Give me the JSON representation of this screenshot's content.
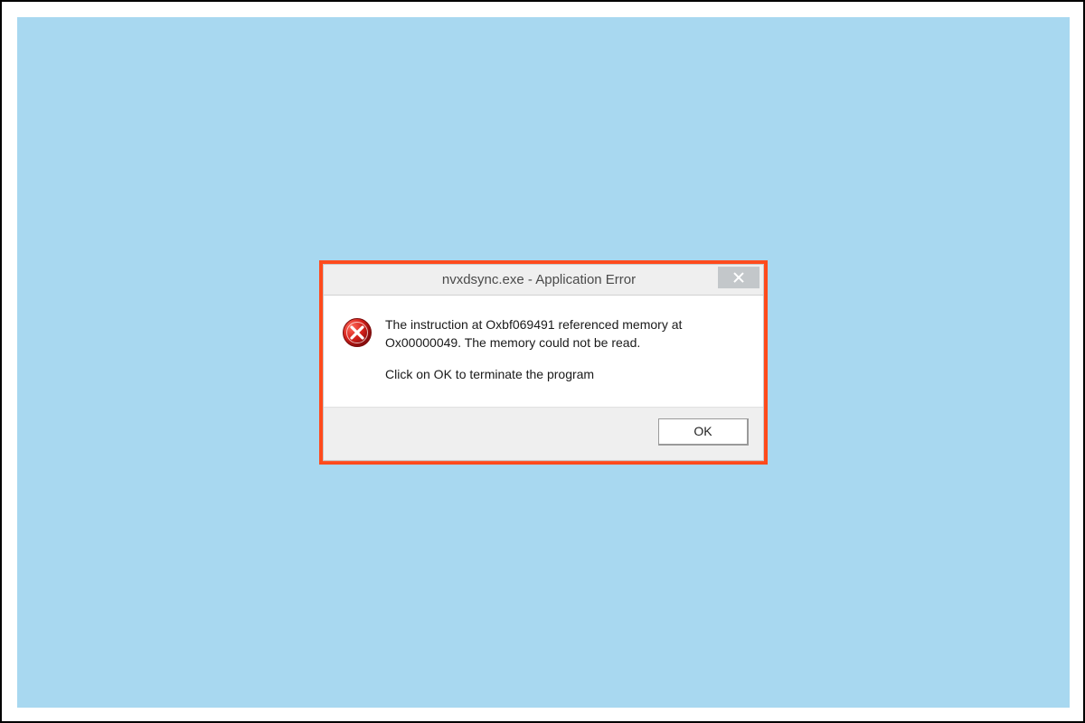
{
  "dialog": {
    "title": "nvxdsync.exe - Application Error",
    "message_line1": "The instruction at Oxbf069491 referenced memory at Ox00000049. The memory could not be read.",
    "message_line2": "Click on OK to terminate the program",
    "ok_label": "OK",
    "icon": "error-x-icon",
    "close_icon": "close-icon"
  }
}
